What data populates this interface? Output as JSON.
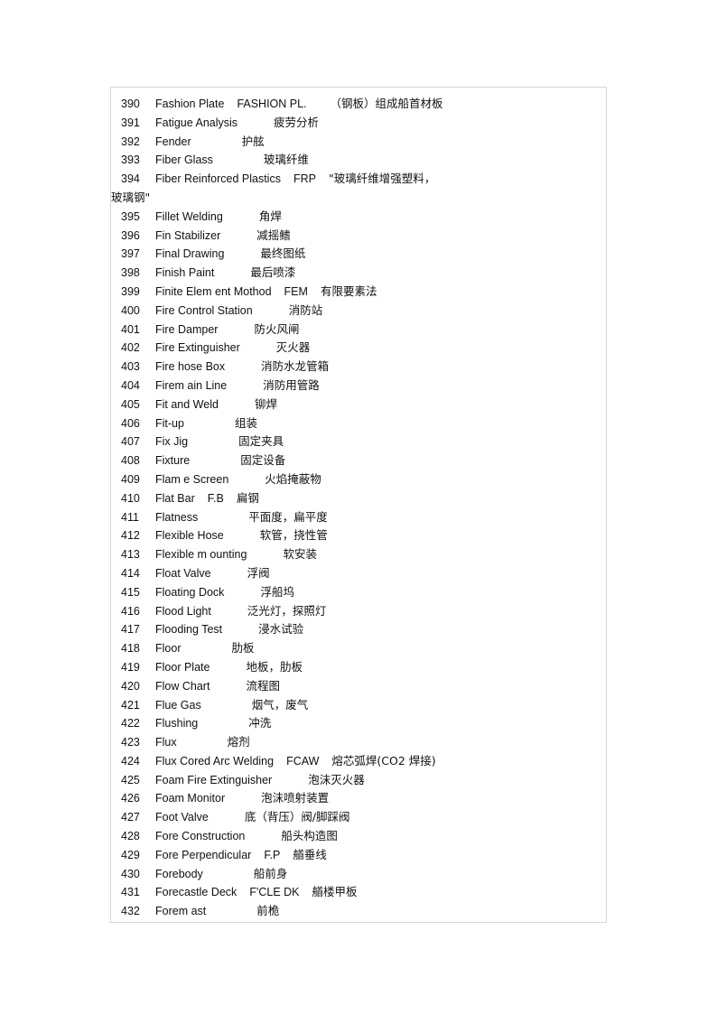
{
  "document": {
    "kind": "bilingual-glossary",
    "language_pair": "English-Chinese",
    "first_entry_number": "390",
    "last_entry_number": "432"
  },
  "entries": [
    {
      "num": "390",
      "en": "Fashion Plate",
      "abbr": "FASHION PL.",
      "zh": "（钢板）组成船首材板",
      "gap1": "gap-sm",
      "gap2": "gap-md"
    },
    {
      "num": "391",
      "en": "Fatigue Analysis",
      "abbr": "",
      "zh": "疲劳分析",
      "gap1": "gap-lg",
      "gap2": ""
    },
    {
      "num": "392",
      "en": "Fender",
      "abbr": "",
      "zh": "护舷",
      "gap1": "gap-xl",
      "gap2": ""
    },
    {
      "num": "393",
      "en": "Fiber Glass",
      "abbr": "",
      "zh": "玻璃纤维",
      "gap1": "gap-xl",
      "gap2": ""
    },
    {
      "num": "394",
      "en": "Fiber Reinforced Plastics",
      "abbr": "FRP",
      "zh": "\"玻璃纤维增强塑料，",
      "gap1": "gap-sm",
      "gap2": "gap-sm",
      "continuation": "玻璃钢\""
    },
    {
      "num": "395",
      "en": "Fillet Welding",
      "abbr": "",
      "zh": "角焊",
      "gap1": "gap-lg",
      "gap2": ""
    },
    {
      "num": "396",
      "en": "Fin Stabilizer",
      "abbr": "",
      "zh": "减摇鳍",
      "gap1": "gap-lg",
      "gap2": ""
    },
    {
      "num": "397",
      "en": "Final Drawing",
      "abbr": "",
      "zh": "最终图纸",
      "gap1": "gap-lg",
      "gap2": ""
    },
    {
      "num": "398",
      "en": "Finish Paint",
      "abbr": "",
      "zh": "最后喷漆",
      "gap1": "gap-lg",
      "gap2": ""
    },
    {
      "num": "399",
      "en": "Finite Elem ent Mothod",
      "abbr": "FEM",
      "zh": "有限要素法",
      "gap1": "gap-sm",
      "gap2": "gap-sm"
    },
    {
      "num": "400",
      "en": "Fire Control Station",
      "abbr": "",
      "zh": "消防站",
      "gap1": "gap-lg",
      "gap2": ""
    },
    {
      "num": "401",
      "en": "Fire Damper",
      "abbr": "",
      "zh": "防火风闸",
      "gap1": "gap-lg",
      "gap2": ""
    },
    {
      "num": "402",
      "en": "Fire Extinguisher",
      "abbr": "",
      "zh": "灭火器",
      "gap1": "gap-lg",
      "gap2": ""
    },
    {
      "num": "403",
      "en": "Fire hose Box",
      "abbr": "",
      "zh": "消防水龙管箱",
      "gap1": "gap-lg",
      "gap2": ""
    },
    {
      "num": "404",
      "en": "Firem ain Line",
      "abbr": "",
      "zh": "消防用管路",
      "gap1": "gap-lg",
      "gap2": ""
    },
    {
      "num": "405",
      "en": "Fit and Weld",
      "abbr": "",
      "zh": "铆焊",
      "gap1": "gap-lg",
      "gap2": ""
    },
    {
      "num": "406",
      "en": "Fit-up",
      "abbr": "",
      "zh": "组装",
      "gap1": "gap-xl",
      "gap2": ""
    },
    {
      "num": "407",
      "en": "Fix Jig",
      "abbr": "",
      "zh": "固定夹具",
      "gap1": "gap-xl",
      "gap2": ""
    },
    {
      "num": "408",
      "en": "Fixture",
      "abbr": "",
      "zh": "固定设备",
      "gap1": "gap-xl",
      "gap2": ""
    },
    {
      "num": "409",
      "en": "Flam e Screen",
      "abbr": "",
      "zh": "火焰掩蔽物",
      "gap1": "gap-lg",
      "gap2": ""
    },
    {
      "num": "410",
      "en": "Flat Bar",
      "abbr": "F.B",
      "zh": "扁钢",
      "gap1": "gap-sm",
      "gap2": "gap-sm"
    },
    {
      "num": "411",
      "en": "Flatness",
      "abbr": "",
      "zh": "平面度，扁平度",
      "gap1": "gap-xl",
      "gap2": ""
    },
    {
      "num": "412",
      "en": "Flexible Hose",
      "abbr": "",
      "zh": "软管，挠性管",
      "gap1": "gap-lg",
      "gap2": ""
    },
    {
      "num": "413",
      "en": "Flexible m ounting",
      "abbr": "",
      "zh": "软安装",
      "gap1": "gap-lg",
      "gap2": ""
    },
    {
      "num": "414",
      "en": "Float Valve",
      "abbr": "",
      "zh": "浮阀",
      "gap1": "gap-lg",
      "gap2": ""
    },
    {
      "num": "415",
      "en": "Floating Dock",
      "abbr": "",
      "zh": "浮船坞",
      "gap1": "gap-lg",
      "gap2": ""
    },
    {
      "num": "416",
      "en": "Flood Light",
      "abbr": "",
      "zh": "泛光灯，探照灯",
      "gap1": "gap-lg",
      "gap2": ""
    },
    {
      "num": "417",
      "en": "Flooding Test",
      "abbr": "",
      "zh": "浸水试验",
      "gap1": "gap-lg",
      "gap2": ""
    },
    {
      "num": "418",
      "en": "Floor",
      "abbr": "",
      "zh": "肋板",
      "gap1": "gap-xl",
      "gap2": ""
    },
    {
      "num": "419",
      "en": "Floor Plate",
      "abbr": "",
      "zh": "地板，肋板",
      "gap1": "gap-lg",
      "gap2": ""
    },
    {
      "num": "420",
      "en": "Flow Chart",
      "abbr": "",
      "zh": "流程图",
      "gap1": "gap-lg",
      "gap2": ""
    },
    {
      "num": "421",
      "en": "Flue Gas",
      "abbr": "",
      "zh": "烟气，废气",
      "gap1": "gap-xl",
      "gap2": ""
    },
    {
      "num": "422",
      "en": "Flushing",
      "abbr": "",
      "zh": "冲洗",
      "gap1": "gap-xl",
      "gap2": ""
    },
    {
      "num": "423",
      "en": "Flux",
      "abbr": "",
      "zh": "熔剂",
      "gap1": "gap-xl",
      "gap2": ""
    },
    {
      "num": "424",
      "en": "Flux Cored Arc Welding",
      "abbr": "FCAW",
      "zh": "熔芯弧焊(CO2 焊接)",
      "gap1": "gap-sm",
      "gap2": "gap-sm"
    },
    {
      "num": "425",
      "en": "Foam Fire Extinguisher",
      "abbr": "",
      "zh": "泡沫灭火器",
      "gap1": "gap-lg",
      "gap2": ""
    },
    {
      "num": "426",
      "en": "Foam Monitor",
      "abbr": "",
      "zh": "泡沫喷射装置",
      "gap1": "gap-lg",
      "gap2": ""
    },
    {
      "num": "427",
      "en": "Foot Valve",
      "abbr": "",
      "zh": "底（背压）阀/脚踩阀",
      "gap1": "gap-lg",
      "gap2": ""
    },
    {
      "num": "428",
      "en": "Fore Construction",
      "abbr": "",
      "zh": "船头构造图",
      "gap1": "gap-lg",
      "gap2": ""
    },
    {
      "num": "429",
      "en": "Fore Perpendicular",
      "abbr": "F.P",
      "zh": "艏垂线",
      "gap1": "gap-sm",
      "gap2": "gap-sm"
    },
    {
      "num": "430",
      "en": "Forebody",
      "abbr": "",
      "zh": "船前身",
      "gap1": "gap-xl",
      "gap2": ""
    },
    {
      "num": "431",
      "en": "Forecastle Deck",
      "abbr": "F'CLE DK",
      "zh": "艏楼甲板",
      "gap1": "gap-sm",
      "gap2": "gap-sm"
    },
    {
      "num": "432",
      "en": "Forem ast",
      "abbr": "",
      "zh": "前桅",
      "gap1": "gap-xl",
      "gap2": ""
    }
  ],
  "colors": {
    "page_background": "#ffffff",
    "frame_border": "#d5d5d5",
    "text": "#101010"
  }
}
